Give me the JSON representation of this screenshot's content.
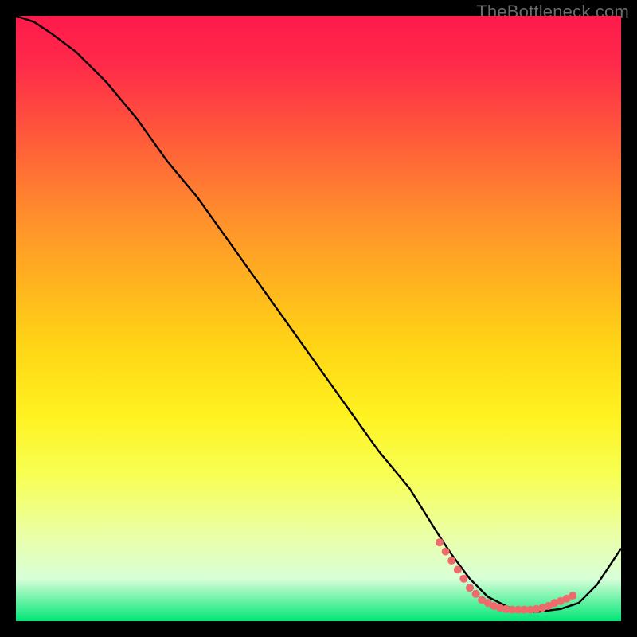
{
  "watermark": "TheBottleneck.com",
  "chart_data": {
    "type": "line",
    "title": "",
    "xlabel": "",
    "ylabel": "",
    "xlim": [
      0,
      100
    ],
    "ylim": [
      0,
      100
    ],
    "grid": false,
    "legend": false,
    "background": "red-yellow-green vertical gradient",
    "series": [
      {
        "name": "curve",
        "color": "#000000",
        "x": [
          0,
          3,
          6,
          10,
          15,
          20,
          25,
          30,
          35,
          40,
          45,
          50,
          55,
          60,
          65,
          70,
          72,
          75,
          78,
          82,
          86,
          90,
          93,
          96,
          100
        ],
        "y": [
          100,
          99,
          97,
          94,
          89,
          83,
          76,
          70,
          63,
          56,
          49,
          42,
          35,
          28,
          22,
          14,
          11,
          7,
          4,
          2,
          1.5,
          2,
          3,
          6,
          12
        ]
      }
    ],
    "markers": {
      "name": "dotted-segment",
      "color": "#ef6a6a",
      "x": [
        70,
        71,
        72,
        73,
        74,
        75,
        76,
        77,
        78,
        79,
        80,
        81,
        82,
        83,
        84,
        85,
        86,
        87,
        88,
        89,
        90,
        91,
        92
      ],
      "y": [
        13,
        11.5,
        10,
        8.5,
        7,
        5.5,
        4.5,
        3.5,
        3,
        2.5,
        2.2,
        2,
        1.9,
        1.9,
        1.9,
        1.9,
        2,
        2.2,
        2.5,
        3,
        3.3,
        3.7,
        4.2
      ]
    }
  }
}
